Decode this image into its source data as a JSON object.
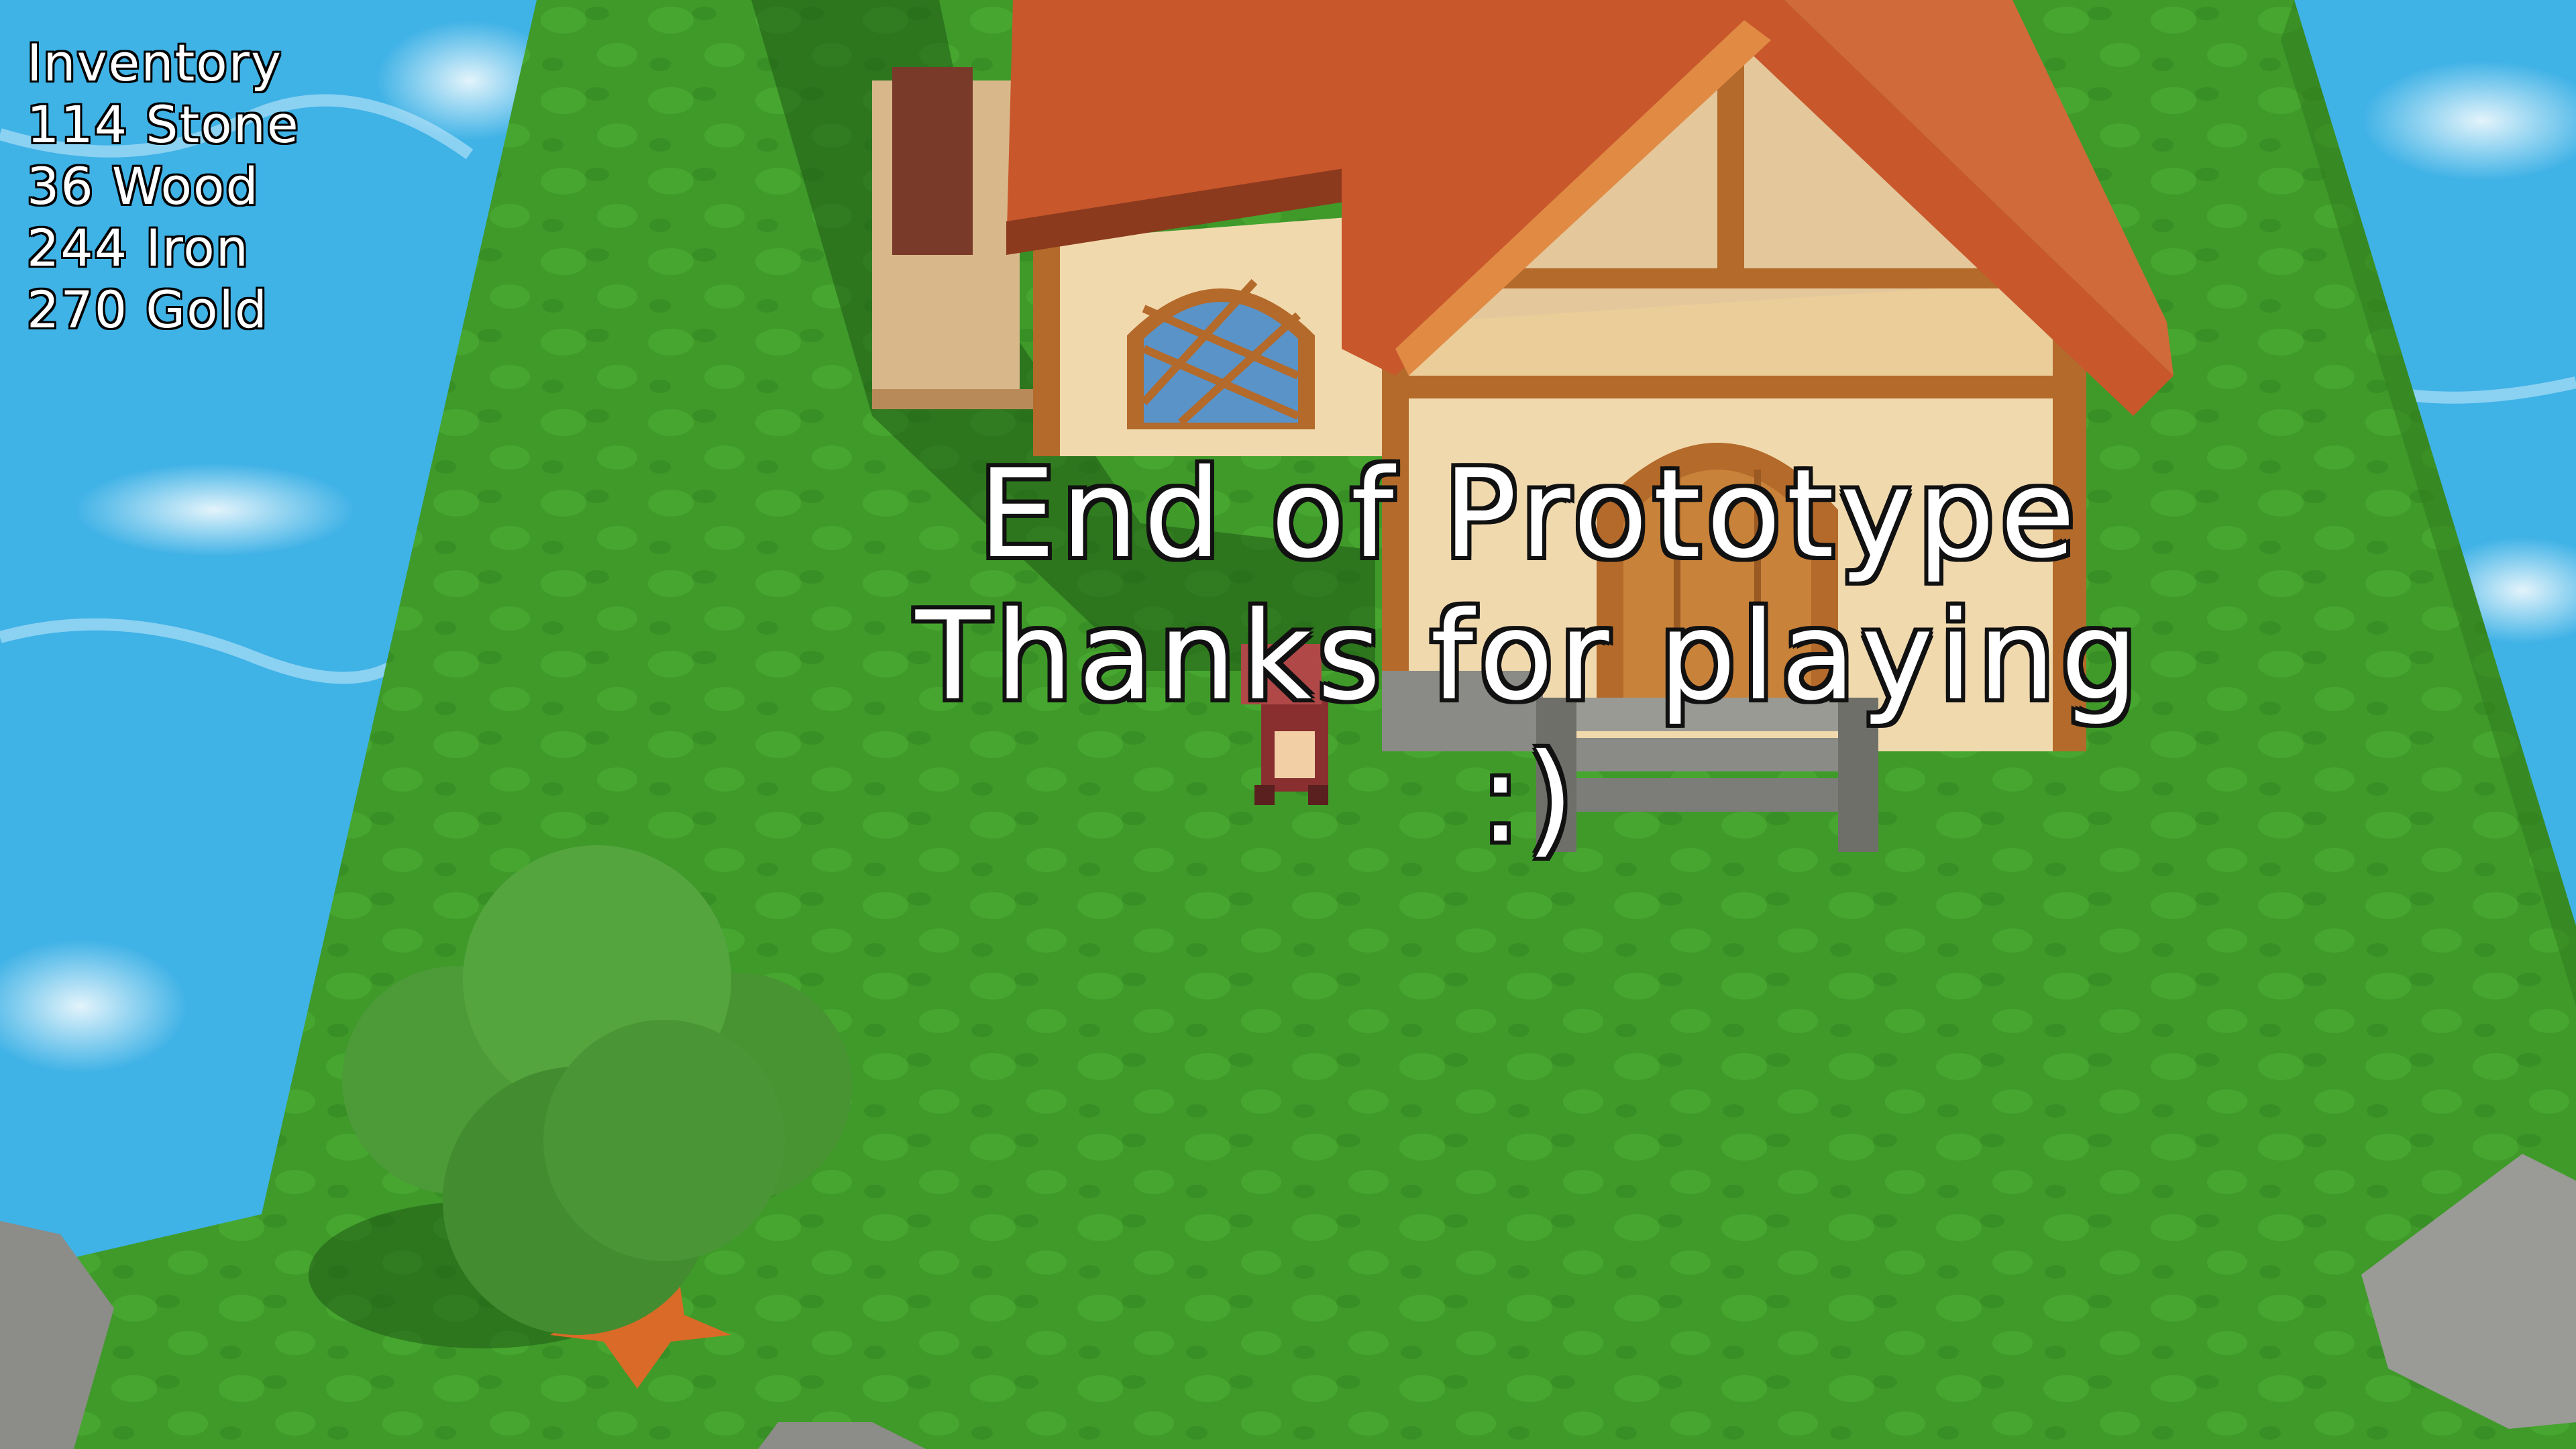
{
  "hud": {
    "inventory_title": "Inventory",
    "items": [
      "114 Stone",
      "36 Wood",
      "244 Iron",
      "270 Gold"
    ]
  },
  "end_screen": {
    "line1": "End of Prototype",
    "line2": "Thanks for playing",
    "line3": ":)"
  },
  "colors": {
    "water": "#3fb2e6",
    "grass": "#3f9a2a",
    "roof": "#c8572c",
    "wall": "#f1d9ae",
    "timber": "#b36a2a",
    "stone": "#8a8a86",
    "tree": "#4c9a38"
  }
}
